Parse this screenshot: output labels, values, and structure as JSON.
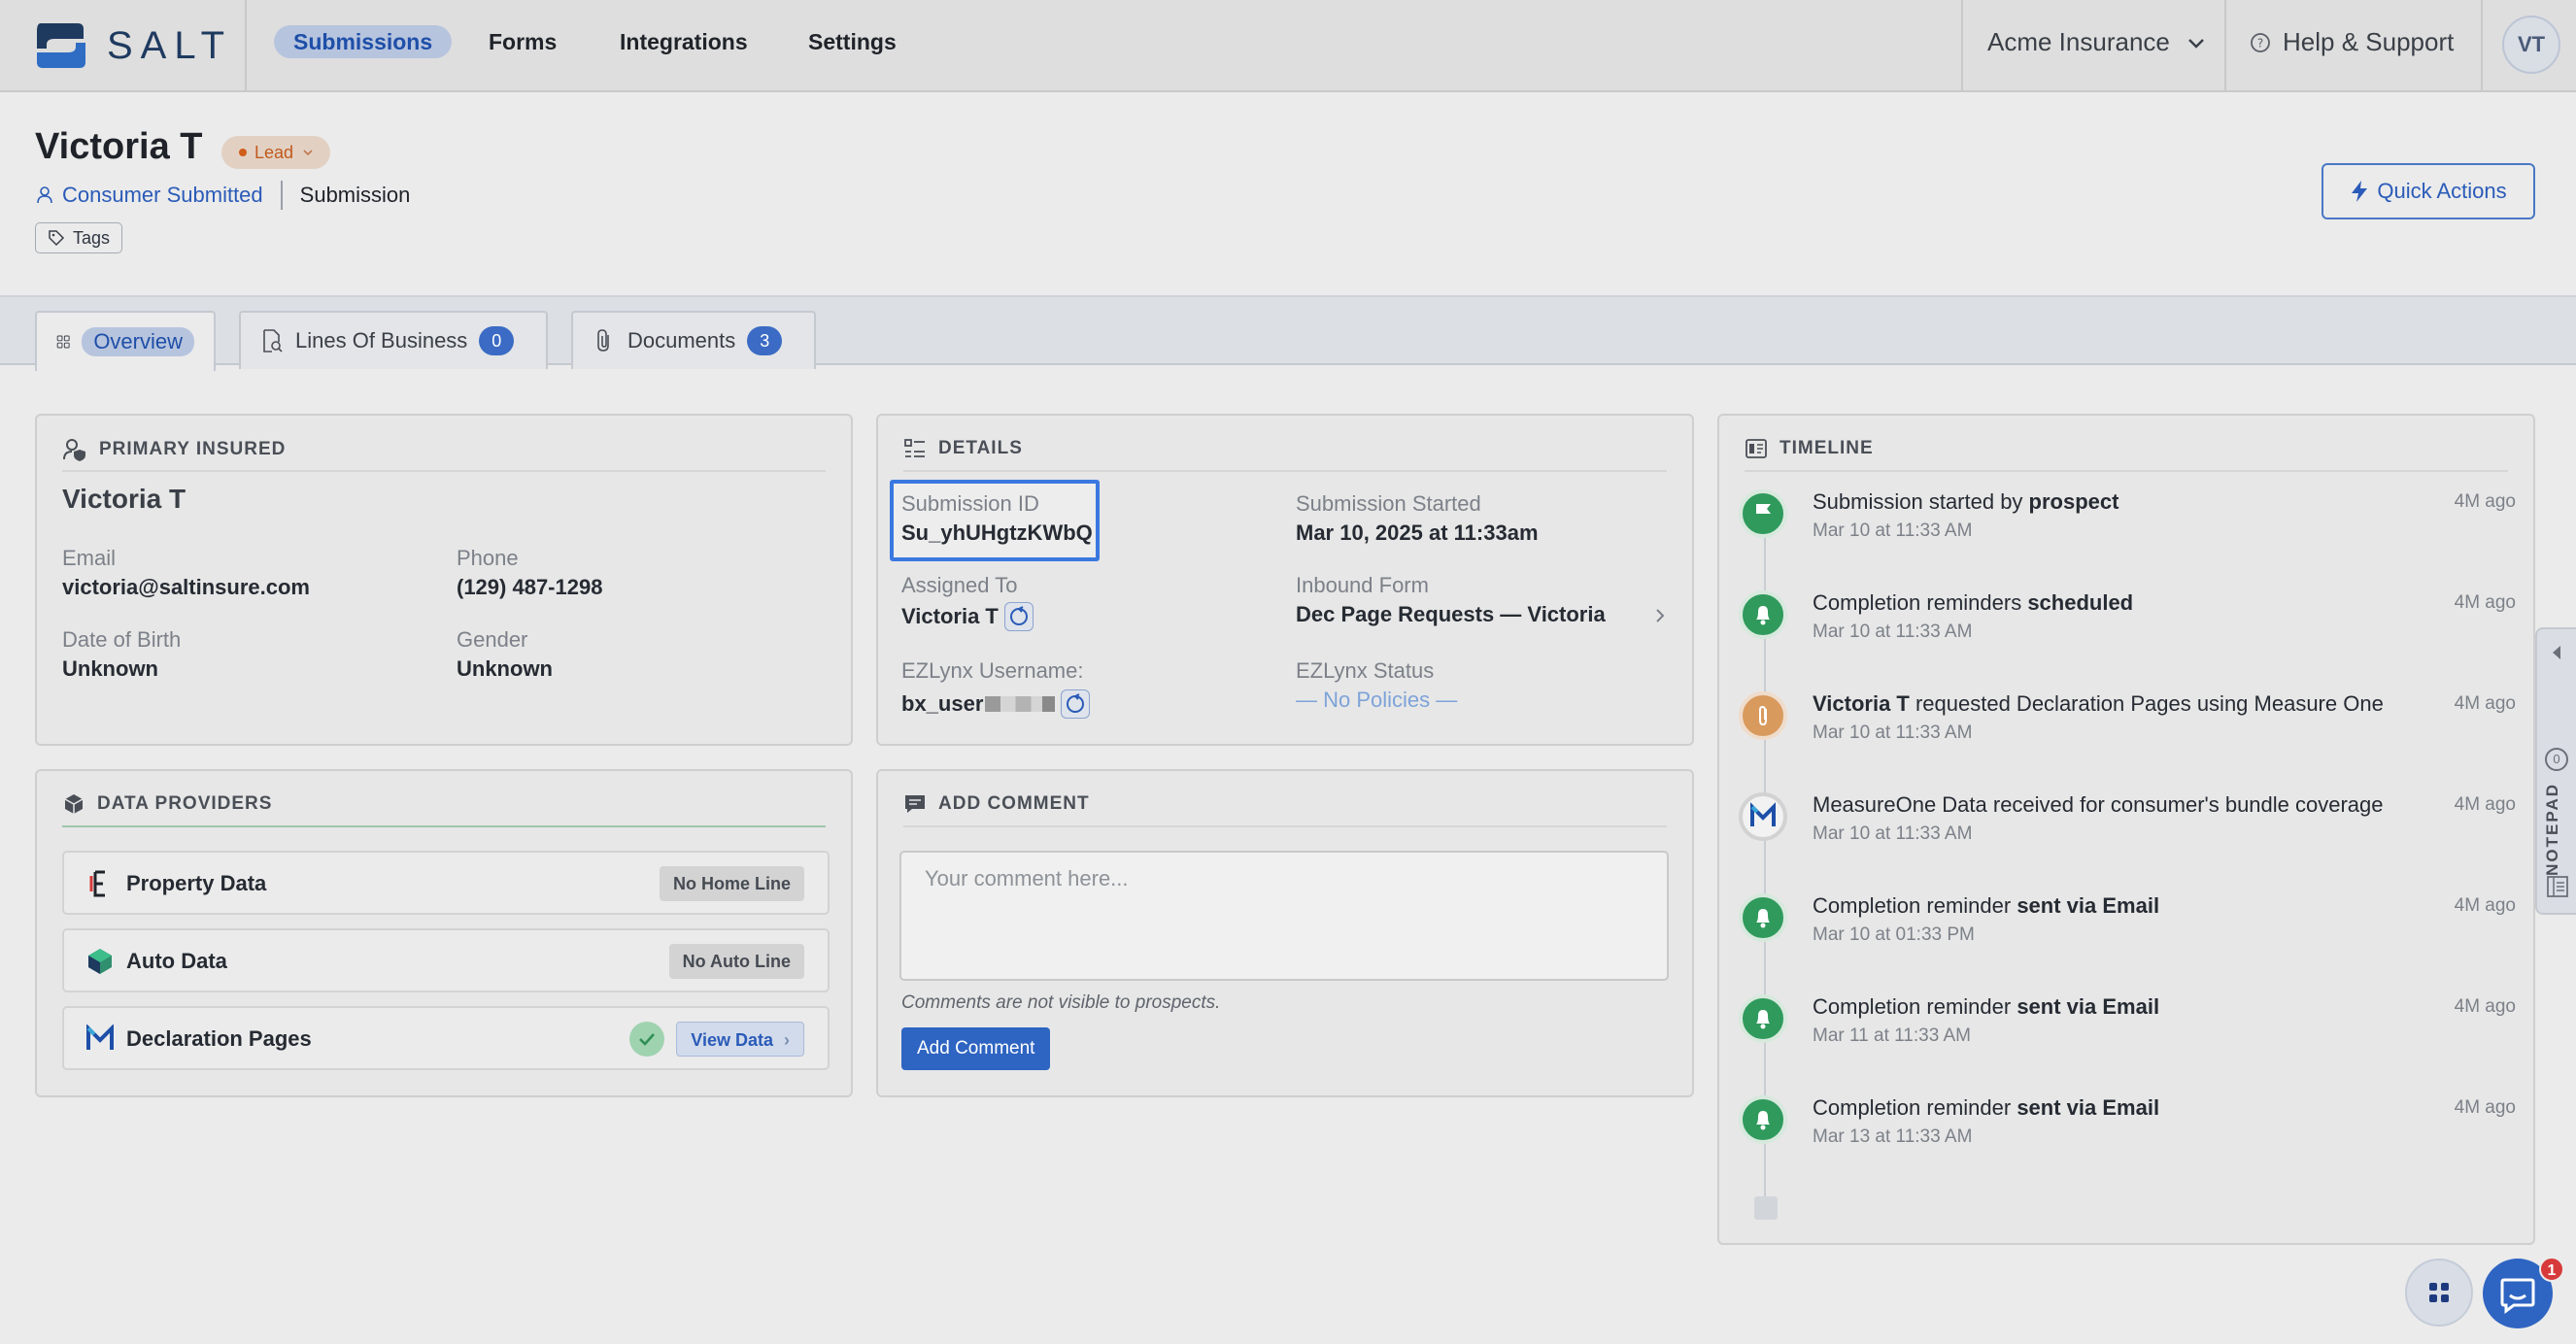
{
  "app": {
    "logo_text": "SALT",
    "nav": [
      "Submissions",
      "Forms",
      "Integrations",
      "Settings"
    ],
    "org": "Acme Insurance",
    "help": "Help & Support",
    "avatar": "VT"
  },
  "header": {
    "name": "Victoria T",
    "status": "Lead",
    "source": "Consumer Submitted",
    "type": "Submission",
    "tags_label": "Tags",
    "quick_actions": "Quick Actions"
  },
  "tabs": [
    {
      "label": "Overview",
      "count": null,
      "active": true
    },
    {
      "label": "Lines Of Business",
      "count": "0",
      "active": false
    },
    {
      "label": "Documents",
      "count": "3",
      "active": false
    }
  ],
  "primary_insured": {
    "heading": "PRIMARY INSURED",
    "name": "Victoria T",
    "email_label": "Email",
    "email": "victoria@saltinsure.com",
    "phone_label": "Phone",
    "phone": "(129) 487-1298",
    "dob_label": "Date of Birth",
    "dob": "Unknown",
    "gender_label": "Gender",
    "gender": "Unknown"
  },
  "details": {
    "heading": "DETAILS",
    "submission_id_label": "Submission ID",
    "submission_id": "Su_yhUHgtzKWbQ",
    "started_label": "Submission Started",
    "started": "Mar 10, 2025 at 11:33am",
    "assigned_label": "Assigned To",
    "assigned": "Victoria T",
    "inbound_label": "Inbound Form",
    "inbound": "Dec Page Requests — Victoria",
    "ezlynx_user_label": "EZLynx Username:",
    "ezlynx_user": "bx_user",
    "ezlynx_status_label": "EZLynx Status",
    "ezlynx_status": "— No Policies —"
  },
  "data_providers": {
    "heading": "DATA PROVIDERS",
    "items": [
      {
        "name": "Property Data",
        "action": "No Home Line"
      },
      {
        "name": "Auto Data",
        "action": "No Auto Line"
      },
      {
        "name": "Declaration Pages",
        "action": "View Data"
      }
    ]
  },
  "comment": {
    "heading": "ADD COMMENT",
    "placeholder": "Your comment here...",
    "note": "Comments are not visible to prospects.",
    "button": "Add Comment"
  },
  "timeline": {
    "heading": "TIMELINE",
    "items": [
      {
        "pre": "Submission started by ",
        "bold": "prospect",
        "post": "",
        "time": "Mar 10 at 11:33 AM",
        "ago": "4M ago",
        "icon": "flag-icon"
      },
      {
        "pre": "Completion reminders ",
        "bold": "scheduled",
        "post": "",
        "time": "Mar 10 at 11:33 AM",
        "ago": "4M ago",
        "icon": "bell-icon"
      },
      {
        "pre": "",
        "bold": "Victoria T",
        "post": " requested Declaration Pages using Measure One",
        "time": "Mar 10 at 11:33 AM",
        "ago": "4M ago",
        "icon": "paperclip-icon"
      },
      {
        "pre": "MeasureOne Data received for consumer's bundle coverage",
        "bold": "",
        "post": "",
        "time": "Mar 10 at 11:33 AM",
        "ago": "4M ago",
        "icon": "measureone-icon"
      },
      {
        "pre": "Completion reminder ",
        "bold": "sent via Email",
        "post": "",
        "time": "Mar 10 at 01:33 PM",
        "ago": "4M ago",
        "icon": "bell-icon"
      },
      {
        "pre": "Completion reminder ",
        "bold": "sent via Email",
        "post": "",
        "time": "Mar 11 at 11:33 AM",
        "ago": "4M ago",
        "icon": "bell-icon"
      },
      {
        "pre": "Completion reminder ",
        "bold": "sent via Email",
        "post": "",
        "time": "Mar 13 at 11:33 AM",
        "ago": "4M ago",
        "icon": "bell-icon"
      }
    ]
  },
  "notepad": {
    "label": "NOTEPAD",
    "count": "0"
  },
  "chat": {
    "badge": "1"
  }
}
